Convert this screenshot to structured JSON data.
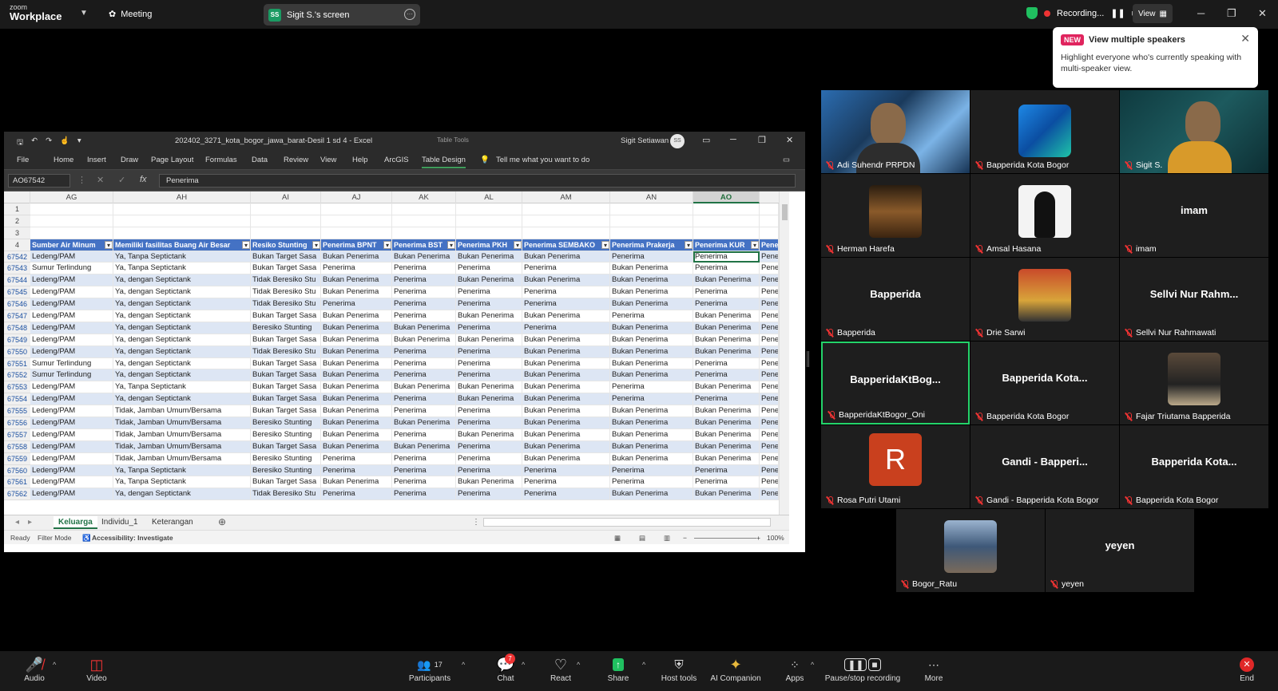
{
  "topbar": {
    "logo_small": "zoom",
    "logo_big": "Workplace",
    "meeting": "Meeting",
    "screen_badge": "SS",
    "screen_label": "Sigit S.'s screen",
    "recording": "Recording...",
    "view": "View"
  },
  "tooltip": {
    "badge": "NEW",
    "title": "View multiple speakers",
    "body": "Highlight everyone who's currently speaking with multi-speaker view."
  },
  "excel": {
    "filename": "202402_3271_kota_bogor_jawa_barat-Desil 1 sd 4  -  Excel",
    "table_tools": "Table Tools",
    "user": "Sigit Setiawan",
    "avatar": "SS",
    "ribbon": [
      "File",
      "Home",
      "Insert",
      "Draw",
      "Page Layout",
      "Formulas",
      "Data",
      "Review",
      "View",
      "Help",
      "ArcGIS",
      "Table Design"
    ],
    "tell_me": "Tell me what you want to do",
    "namebox": "AO67542",
    "formula": "Penerima",
    "columns": [
      "AG",
      "AH",
      "AI",
      "AJ",
      "AK",
      "AL",
      "AM",
      "AN",
      "AO"
    ],
    "row_numbers": [
      "1",
      "2",
      "3",
      "4",
      "67542",
      "67543",
      "67544",
      "67545",
      "67546",
      "67547",
      "67548",
      "67549",
      "67550",
      "67551",
      "67552",
      "67553",
      "67554",
      "67555",
      "67556",
      "67557",
      "67558",
      "67559",
      "67560",
      "67561",
      "67562"
    ],
    "headers": [
      "Sumber Air Minum",
      "Memiliki fasilitas Buang Air Besar",
      "Resiko Stunting",
      "Penerima BPNT",
      "Penerima BST",
      "Penerima PKH",
      "Penerima SEMBAKO",
      "Penerima Prakerja",
      "Penerima KUR",
      "Pene"
    ],
    "rows": [
      [
        "Ledeng/PAM",
        "Ya, Tanpa Septictank",
        "Bukan Target Sasa",
        "Bukan Penerima",
        "Bukan Penerima",
        "Bukan Penerima",
        "Bukan Penerima",
        "Penerima",
        "Penerima",
        "Pene"
      ],
      [
        "Sumur Terlindung",
        "Ya, Tanpa Septictank",
        "Bukan Target Sasa",
        "Penerima",
        "Penerima",
        "Penerima",
        "Penerima",
        "Bukan Penerima",
        "Penerima",
        "Pene"
      ],
      [
        "Ledeng/PAM",
        "Ya, dengan Septictank",
        "Tidak Beresiko Stu",
        "Bukan Penerima",
        "Penerima",
        "Bukan Penerima",
        "Bukan Penerima",
        "Bukan Penerima",
        "Bukan Penerima",
        "Pene"
      ],
      [
        "Ledeng/PAM",
        "Ya, dengan Septictank",
        "Tidak Beresiko Stu",
        "Bukan Penerima",
        "Penerima",
        "Penerima",
        "Penerima",
        "Bukan Penerima",
        "Penerima",
        "Pene"
      ],
      [
        "Ledeng/PAM",
        "Ya, dengan Septictank",
        "Tidak Beresiko Stu",
        "Penerima",
        "Penerima",
        "Penerima",
        "Penerima",
        "Bukan Penerima",
        "Penerima",
        "Pene"
      ],
      [
        "Ledeng/PAM",
        "Ya, dengan Septictank",
        "Bukan Target Sasa",
        "Bukan Penerima",
        "Penerima",
        "Bukan Penerima",
        "Bukan Penerima",
        "Penerima",
        "Bukan Penerima",
        "Pene"
      ],
      [
        "Ledeng/PAM",
        "Ya, dengan Septictank",
        "Beresiko Stunting",
        "Bukan Penerima",
        "Bukan Penerima",
        "Penerima",
        "Penerima",
        "Bukan Penerima",
        "Bukan Penerima",
        "Pene"
      ],
      [
        "Ledeng/PAM",
        "Ya, dengan Septictank",
        "Bukan Target Sasa",
        "Bukan Penerima",
        "Bukan Penerima",
        "Bukan Penerima",
        "Bukan Penerima",
        "Bukan Penerima",
        "Bukan Penerima",
        "Pene"
      ],
      [
        "Ledeng/PAM",
        "Ya, dengan Septictank",
        "Tidak Beresiko Stu",
        "Bukan Penerima",
        "Penerima",
        "Penerima",
        "Bukan Penerima",
        "Bukan Penerima",
        "Bukan Penerima",
        "Pene"
      ],
      [
        "Sumur Terlindung",
        "Ya, dengan Septictank",
        "Bukan Target Sasa",
        "Bukan Penerima",
        "Penerima",
        "Penerima",
        "Bukan Penerima",
        "Bukan Penerima",
        "Penerima",
        "Pene"
      ],
      [
        "Sumur Terlindung",
        "Ya, dengan Septictank",
        "Bukan Target Sasa",
        "Bukan Penerima",
        "Penerima",
        "Penerima",
        "Bukan Penerima",
        "Bukan Penerima",
        "Penerima",
        "Pene"
      ],
      [
        "Ledeng/PAM",
        "Ya, Tanpa Septictank",
        "Bukan Target Sasa",
        "Bukan Penerima",
        "Bukan Penerima",
        "Bukan Penerima",
        "Bukan Penerima",
        "Penerima",
        "Bukan Penerima",
        "Pene"
      ],
      [
        "Ledeng/PAM",
        "Ya, dengan Septictank",
        "Bukan Target Sasa",
        "Bukan Penerima",
        "Penerima",
        "Bukan Penerima",
        "Bukan Penerima",
        "Penerima",
        "Penerima",
        "Pene"
      ],
      [
        "Ledeng/PAM",
        "Tidak, Jamban Umum/Bersama",
        "Bukan Target Sasa",
        "Bukan Penerima",
        "Penerima",
        "Penerima",
        "Bukan Penerima",
        "Bukan Penerima",
        "Bukan Penerima",
        "Pene"
      ],
      [
        "Ledeng/PAM",
        "Tidak, Jamban Umum/Bersama",
        "Beresiko Stunting",
        "Bukan Penerima",
        "Bukan Penerima",
        "Penerima",
        "Bukan Penerima",
        "Bukan Penerima",
        "Bukan Penerima",
        "Pene"
      ],
      [
        "Ledeng/PAM",
        "Tidak, Jamban Umum/Bersama",
        "Beresiko Stunting",
        "Bukan Penerima",
        "Penerima",
        "Bukan Penerima",
        "Bukan Penerima",
        "Bukan Penerima",
        "Bukan Penerima",
        "Pene"
      ],
      [
        "Ledeng/PAM",
        "Tidak, Jamban Umum/Bersama",
        "Bukan Target Sasa",
        "Bukan Penerima",
        "Bukan Penerima",
        "Penerima",
        "Bukan Penerima",
        "Bukan Penerima",
        "Bukan Penerima",
        "Pene"
      ],
      [
        "Ledeng/PAM",
        "Tidak, Jamban Umum/Bersama",
        "Beresiko Stunting",
        "Penerima",
        "Penerima",
        "Penerima",
        "Bukan Penerima",
        "Bukan Penerima",
        "Bukan Penerima",
        "Pene"
      ],
      [
        "Ledeng/PAM",
        "Ya, Tanpa Septictank",
        "Beresiko Stunting",
        "Penerima",
        "Penerima",
        "Penerima",
        "Penerima",
        "Penerima",
        "Penerima",
        "Pene"
      ],
      [
        "Ledeng/PAM",
        "Ya, Tanpa Septictank",
        "Bukan Target Sasa",
        "Bukan Penerima",
        "Penerima",
        "Bukan Penerima",
        "Penerima",
        "Penerima",
        "Penerima",
        "Pene"
      ],
      [
        "Ledeng/PAM",
        "Ya, dengan Septictank",
        "Tidak Beresiko Stu",
        "Penerima",
        "Penerima",
        "Penerima",
        "Penerima",
        "Bukan Penerima",
        "Bukan Penerima",
        "Pene"
      ]
    ],
    "sheets": [
      "Keluarga",
      "Individu_1",
      "Keterangan"
    ],
    "status": {
      "ready": "Ready",
      "filter": "Filter Mode",
      "accessibility": "Accessibility: Investigate",
      "zoom": "100%"
    }
  },
  "gallery": [
    {
      "name": "Adi Suhendr PRPDN",
      "big": ""
    },
    {
      "name": "Bapperida Kota Bogor",
      "big": ""
    },
    {
      "name": "Sigit S.",
      "big": ""
    },
    {
      "name": "Herman Harefa",
      "big": ""
    },
    {
      "name": "Amsal Hasana",
      "big": ""
    },
    {
      "name": "imam",
      "big": "imam"
    },
    {
      "name": "Bapperida",
      "big": "Bapperida"
    },
    {
      "name": "Drie Sarwi",
      "big": ""
    },
    {
      "name": "Sellvi Nur Rahmawati",
      "big": "Sellvi Nur Rahm..."
    },
    {
      "name": "BapperidaKtBogor_Oni",
      "big": "BapperidaKtBog..."
    },
    {
      "name": "Bapperida Kota Bogor",
      "big": "Bapperida Kota..."
    },
    {
      "name": "Fajar Triutama Bapperida",
      "big": ""
    },
    {
      "name": "Rosa Putri Utami",
      "big": "",
      "initial": "R"
    },
    {
      "name": "Gandi - Bapperida Kota Bogor",
      "big": "Gandi - Bapperi..."
    },
    {
      "name": "Bapperida Kota Bogor",
      "big": "Bapperida Kota..."
    },
    {
      "name": "Bogor_Ratu",
      "big": ""
    },
    {
      "name": "yeyen",
      "big": "yeyen"
    }
  ],
  "toolbar": {
    "audio": "Audio",
    "video": "Video",
    "participants": "Participants",
    "participants_count": "17",
    "chat": "Chat",
    "chat_badge": "7",
    "react": "React",
    "share": "Share",
    "host_tools": "Host tools",
    "ai": "AI Companion",
    "apps": "Apps",
    "pause_rec": "Pause/stop recording",
    "more": "More",
    "end": "End"
  },
  "colors": {
    "zoom_bg": "#1a1a1a",
    "table_header": "#4472c4",
    "table_band": "#dde6f4",
    "excel_green": "#217346",
    "active_speaker": "#24d36a",
    "avatar_red": "#c9401e"
  }
}
